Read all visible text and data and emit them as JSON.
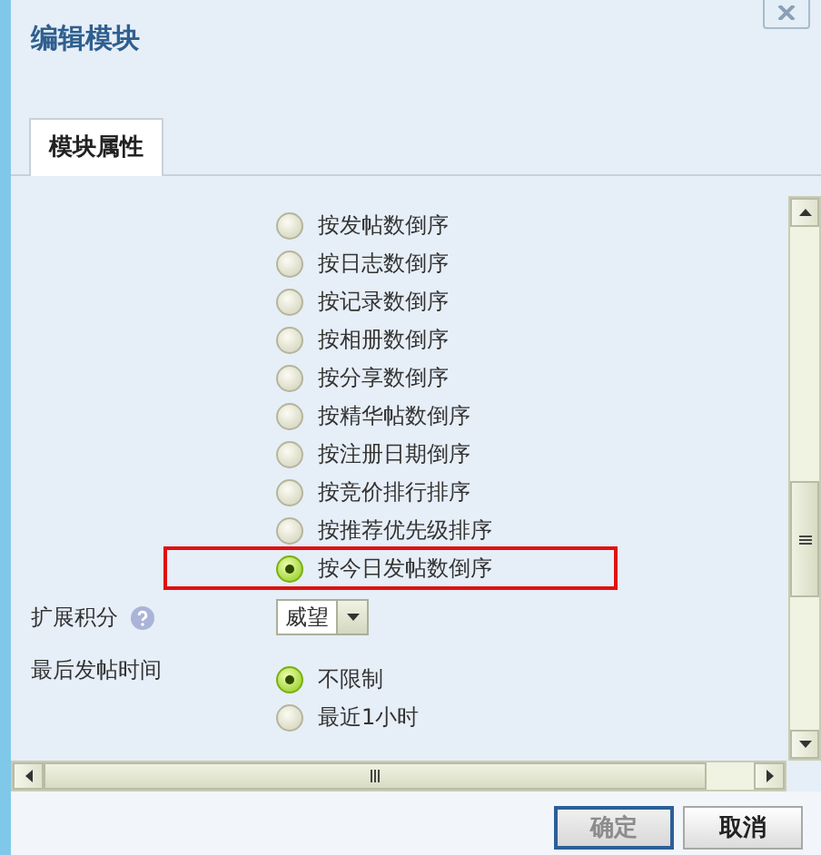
{
  "window": {
    "title": "编辑模块"
  },
  "tabs": [
    {
      "label": "模块属性",
      "selected": true
    }
  ],
  "sort_options": [
    {
      "label": "按发帖数倒序",
      "selected": false
    },
    {
      "label": "按日志数倒序",
      "selected": false
    },
    {
      "label": "按记录数倒序",
      "selected": false
    },
    {
      "label": "按相册数倒序",
      "selected": false
    },
    {
      "label": "按分享数倒序",
      "selected": false
    },
    {
      "label": "按精华帖数倒序",
      "selected": false
    },
    {
      "label": "按注册日期倒序",
      "selected": false
    },
    {
      "label": "按竞价排行排序",
      "selected": false
    },
    {
      "label": "按推荐优先级排序",
      "selected": false
    },
    {
      "label": "按今日发帖数倒序",
      "selected": true
    }
  ],
  "fields": [
    {
      "kind": "select",
      "label": "扩展积分",
      "help": true,
      "value": "威望"
    },
    {
      "kind": "radio",
      "label": "最后发帖时间",
      "options": [
        {
          "label": "不限制",
          "selected": true
        },
        {
          "label": "最近1小时",
          "selected": false
        }
      ]
    }
  ],
  "buttons": [
    {
      "label": "确定",
      "kind": "primary"
    },
    {
      "label": "取消",
      "kind": "secondary"
    }
  ]
}
